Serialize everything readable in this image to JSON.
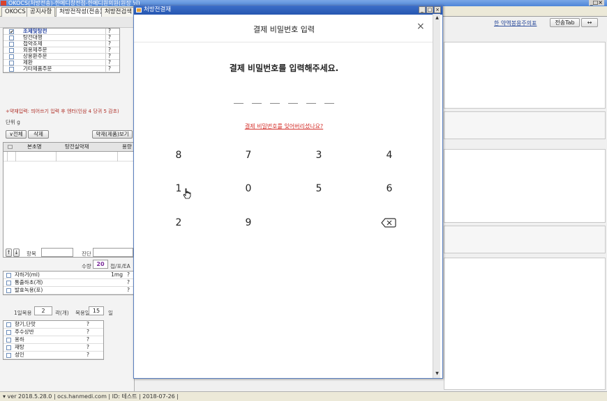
{
  "main_window": {
    "title": "OKOCS(처방전송)-한메디창전점-한메디원의원(원장 님)",
    "controls": "_□×",
    "tabs": [
      {
        "label": "OKOCS"
      },
      {
        "label": "공지사항"
      },
      {
        "label": "처방전작성(전송)"
      },
      {
        "label": "처방전검색"
      }
    ]
  },
  "left_panel": {
    "categories": [
      {
        "label": "조제및탕전",
        "checked": true,
        "q": "?"
      },
      {
        "label": "탕전대행",
        "checked": false,
        "q": "?"
      },
      {
        "label": "첩약조제",
        "checked": false,
        "q": "?"
      },
      {
        "label": "외용제주문",
        "checked": false,
        "q": "?"
      },
      {
        "label": "상용환주문",
        "checked": false,
        "q": "?"
      },
      {
        "label": "제환",
        "checked": false,
        "q": "?"
      },
      {
        "label": "기타제품주문",
        "checked": false,
        "q": "?"
      }
    ],
    "drug_note": "+약재입력: 띄어쓰기 입력 후 엔터(인삼 4 당귀 5 감초)",
    "unit_label": "단위 g",
    "btn_all": "∨전체",
    "btn_delete": "삭제",
    "btn_view": "약재(제품)보기",
    "grid_headers": [
      "본초명",
      "탕전실약재",
      "용량"
    ],
    "item_label": "항목",
    "diagnosis_label": "진단",
    "qty_label": "수량",
    "qty_value": "20",
    "qty_unit": "첩/포/EA",
    "extras": [
      {
        "label": "자하거(ml)",
        "r1": "1mg",
        "r2": "?"
      },
      {
        "label": "통출하초(개)",
        "r2": "?"
      },
      {
        "label": "발효녹용(포)",
        "r2": "?"
      }
    ],
    "daily_label": "1일복용",
    "daily_value": "2",
    "daily_unit": "곽(개)",
    "days_label": "복용일",
    "days_value": "15",
    "days_unit": "일",
    "options": [
      {
        "label": "향기,단맛",
        "q": "?"
      },
      {
        "label": "주수상반",
        "q": "?"
      },
      {
        "label": "용하",
        "q": "?"
      },
      {
        "label": "재탕",
        "q": "?"
      },
      {
        "label": "성인",
        "q": "?"
      }
    ]
  },
  "right_area": {
    "link": "한 약액봉용주의표",
    "btn_tab": "전송Tab",
    "btn_arrow": "↔"
  },
  "status_bar": {
    "text": "▾ ver 2018.5.28.0  |  ocs.hanmedi.com  |  ID: 테스트  |  2018-07-26  |"
  },
  "dialog": {
    "title": "처방전결재",
    "controls": [
      "_",
      "□",
      "×"
    ],
    "pay_title": "결제 비밀번호 입력",
    "close_symbol": "×",
    "prompt": "결제 비밀번호를 입력해주세요.",
    "forgot_link": "결제 비밀번호를 잊어버리셨나요?",
    "keypad": [
      "8",
      "7",
      "3",
      "4",
      "1",
      "0",
      "5",
      "6",
      "2",
      "9"
    ]
  }
}
